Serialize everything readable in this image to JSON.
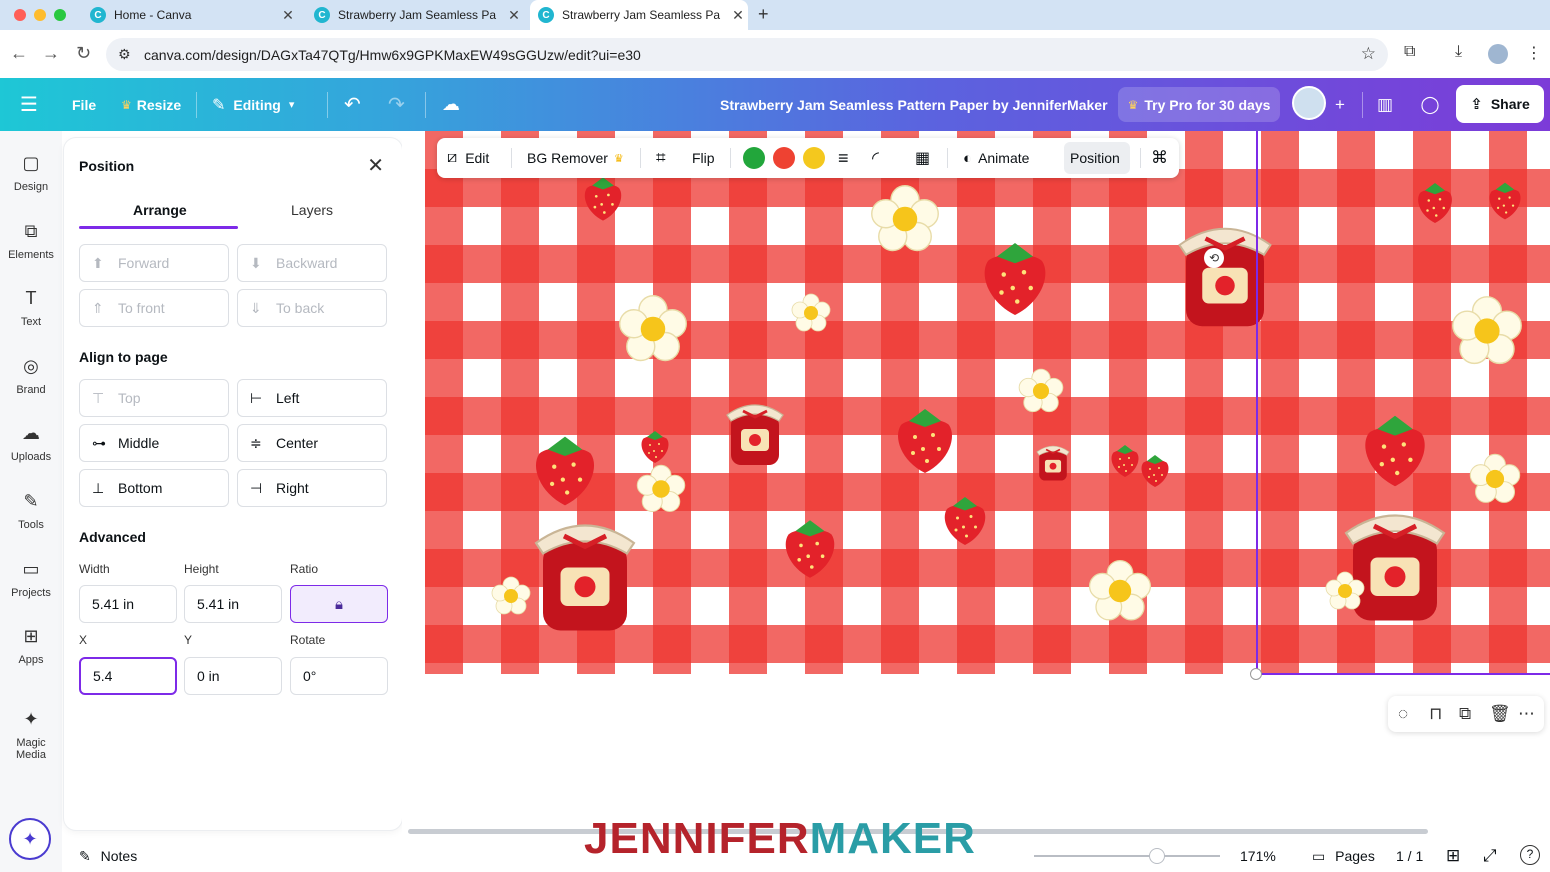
{
  "browser": {
    "tabs": [
      {
        "title": "Home - Canva",
        "active": false
      },
      {
        "title": "Strawberry Jam Seamless Pa",
        "active": false
      },
      {
        "title": "Strawberry Jam Seamless Pa",
        "active": true
      }
    ],
    "url": "canva.com/design/DAGxTa47QTg/Hmw6x9GPKMaxEW49sGGUzw/edit?ui=e30",
    "colors": {
      "tabstrip": "#d3e3f4",
      "close": "#ff5f57",
      "min": "#febc2e",
      "max": "#28c840"
    }
  },
  "topbar": {
    "file": "File",
    "resize": "Resize",
    "editing": "Editing",
    "design_title": "Strawberry Jam Seamless Pattern Paper by JenniferMaker",
    "try_pro": "Try Pro for 30 days",
    "share": "Share"
  },
  "rail": [
    {
      "label": "Design",
      "icon": "design-icon",
      "glyph": "▢"
    },
    {
      "label": "Elements",
      "icon": "elements-icon",
      "glyph": "⧉"
    },
    {
      "label": "Text",
      "icon": "text-icon",
      "glyph": "T"
    },
    {
      "label": "Brand",
      "icon": "brand-icon",
      "glyph": "◎"
    },
    {
      "label": "Uploads",
      "icon": "uploads-icon",
      "glyph": "☁"
    },
    {
      "label": "Tools",
      "icon": "tools-icon",
      "glyph": "✎"
    },
    {
      "label": "Projects",
      "icon": "projects-icon",
      "glyph": "▭"
    },
    {
      "label": "Apps",
      "icon": "apps-icon",
      "glyph": "⊞"
    },
    {
      "label": "Magic Media",
      "icon": "magic-media-icon",
      "glyph": "✦"
    }
  ],
  "panel": {
    "title": "Position",
    "tabs": {
      "arrange": "Arrange",
      "layers": "Layers"
    },
    "arrange_buttons": {
      "forward": "Forward",
      "backward": "Backward",
      "to_front": "To front",
      "to_back": "To back"
    },
    "align_heading": "Align to page",
    "align_buttons": {
      "top": "Top",
      "left": "Left",
      "middle": "Middle",
      "center": "Center",
      "bottom": "Bottom",
      "right": "Right"
    },
    "advanced_heading": "Advanced",
    "labels": {
      "width": "Width",
      "height": "Height",
      "ratio": "Ratio",
      "x": "X",
      "y": "Y",
      "rotate": "Rotate"
    },
    "values": {
      "width": "5.41 in",
      "height": "5.41 in",
      "x": "5.4",
      "y": "0 in",
      "rotate": "0°"
    }
  },
  "context_toolbar": {
    "edit": "Edit",
    "bg_remover": "BG Remover",
    "flip": "Flip",
    "animate": "Animate",
    "position": "Position",
    "swatches": [
      "#22a63b",
      "#ee4232",
      "#f4c81e"
    ]
  },
  "bottombar": {
    "notes": "Notes",
    "zoom": "171%",
    "pages": "Pages",
    "page_count": "1 / 1",
    "zoom_level": 0.66
  },
  "watermark": {
    "part1": "JENNIFER",
    "part2": "MAKER",
    "color1": "#b5232b",
    "color2": "#2a9da6"
  },
  "colors": {
    "accent": "#7d2ae8",
    "gingham": "#ee3630"
  }
}
